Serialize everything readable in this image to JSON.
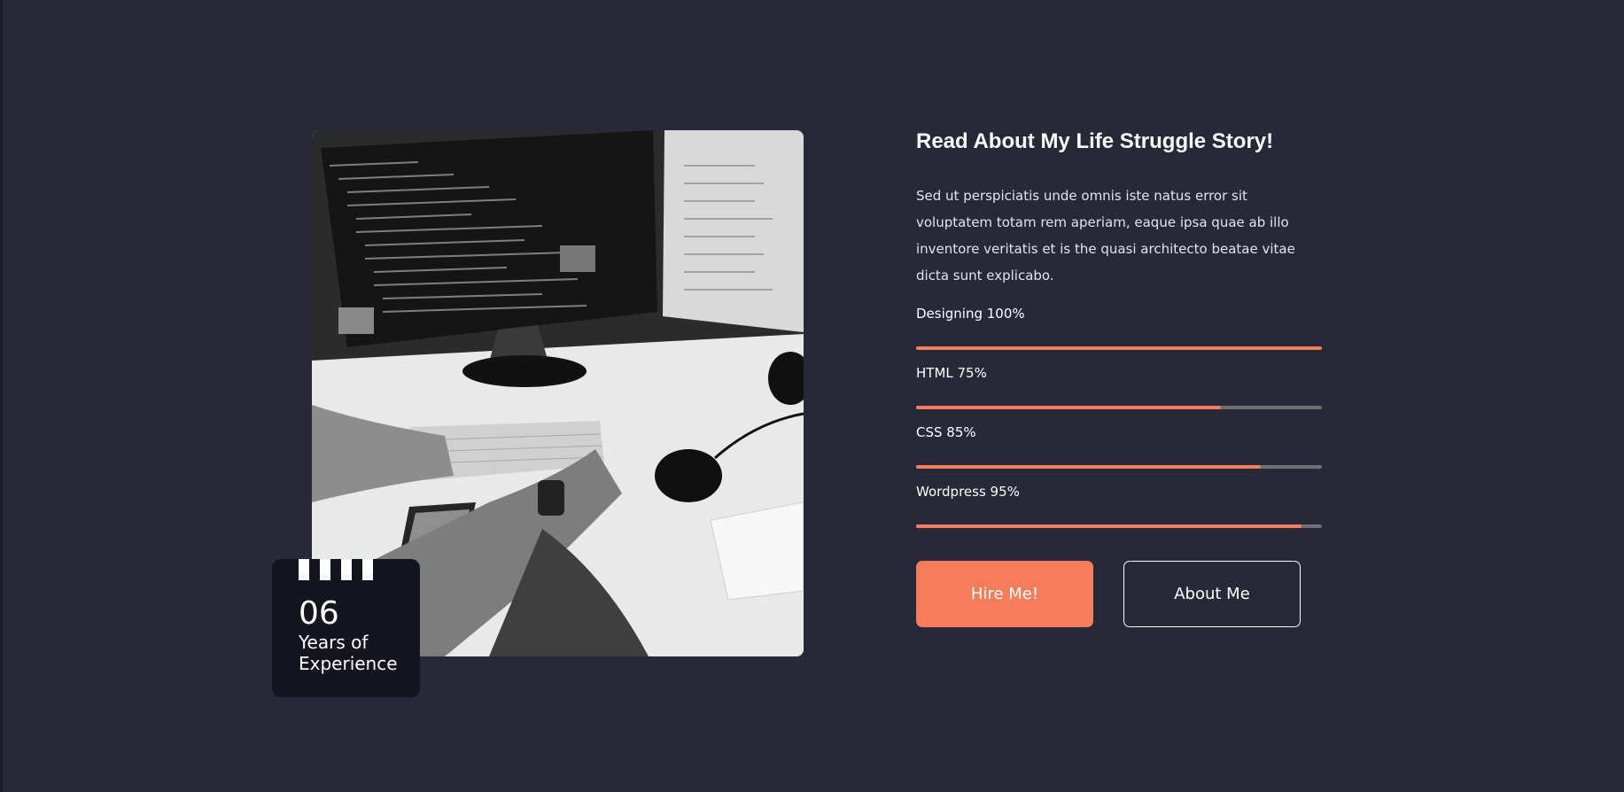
{
  "experience": {
    "number": "06",
    "label": "Years of Experience"
  },
  "about": {
    "title": "Read About My Life Struggle Story!",
    "description": "Sed ut perspiciatis unde omnis iste natus error sit voluptatem totam rem aperiam, eaque ipsa quae ab illo inventore veritatis et is the quasi architecto beatae vitae dicta sunt explicabo."
  },
  "skills": [
    {
      "label": "Designing 100%",
      "percent": 100
    },
    {
      "label": "HTML 75%",
      "percent": 75
    },
    {
      "label": "CSS 85%",
      "percent": 85
    },
    {
      "label": "Wordpress 95%",
      "percent": 95
    }
  ],
  "buttons": {
    "hire": "Hire Me!",
    "about": "About Me"
  },
  "colors": {
    "background": "#272838",
    "accent": "#f77c5a",
    "card": "#151520"
  }
}
